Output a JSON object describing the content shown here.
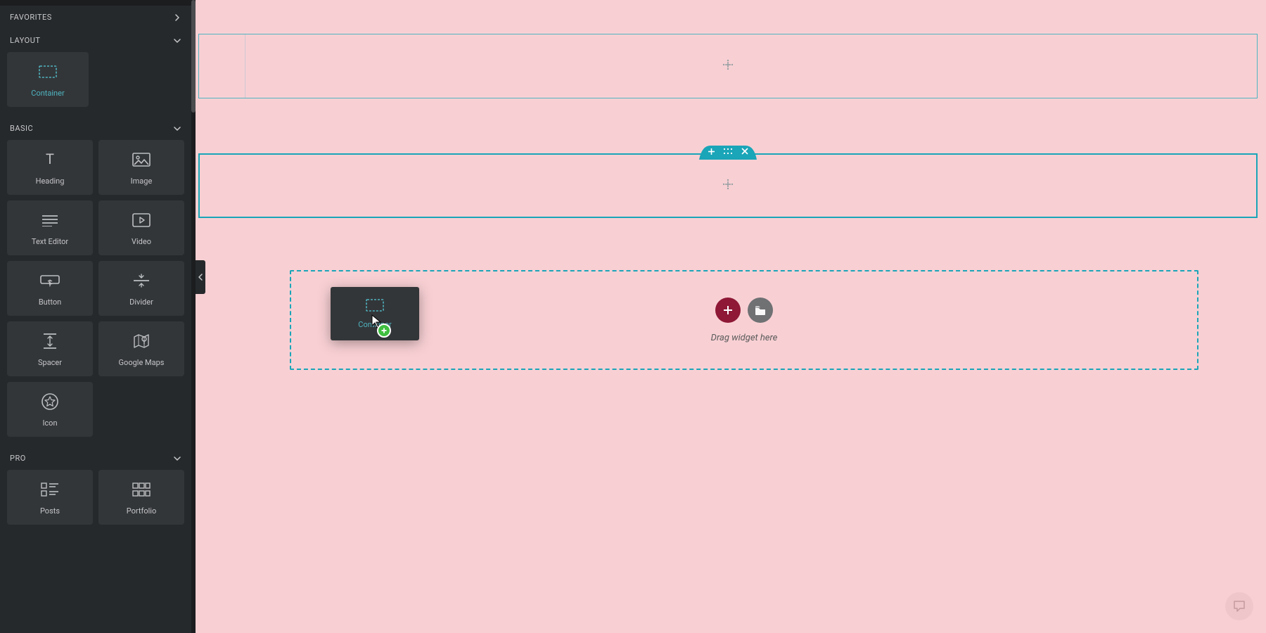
{
  "colors": {
    "accent": "#1aa5b8",
    "sidebar_bg": "#26292c",
    "canvas_bg": "#f8d0d4",
    "add_btn": "#8e1836",
    "lib_btn": "#6f7173",
    "drop_ok": "#3fbf3f"
  },
  "sidebar": {
    "sections": {
      "favorites": {
        "label": "FAVORITES",
        "expanded": false
      },
      "layout": {
        "label": "LAYOUT",
        "expanded": true,
        "widgets": [
          {
            "id": "container",
            "label": "Container"
          }
        ]
      },
      "basic": {
        "label": "BASIC",
        "expanded": true,
        "widgets": [
          {
            "id": "heading",
            "label": "Heading"
          },
          {
            "id": "image",
            "label": "Image"
          },
          {
            "id": "text-editor",
            "label": "Text Editor"
          },
          {
            "id": "video",
            "label": "Video"
          },
          {
            "id": "button",
            "label": "Button"
          },
          {
            "id": "divider",
            "label": "Divider"
          },
          {
            "id": "spacer",
            "label": "Spacer"
          },
          {
            "id": "google-maps",
            "label": "Google Maps"
          },
          {
            "id": "icon",
            "label": "Icon"
          }
        ]
      },
      "pro": {
        "label": "PRO",
        "expanded": true,
        "widgets": [
          {
            "id": "posts",
            "label": "Posts"
          },
          {
            "id": "portfolio",
            "label": "Portfolio"
          }
        ]
      }
    }
  },
  "canvas": {
    "dropzone_text": "Drag widget here",
    "drag_ghost_label": "Container"
  }
}
